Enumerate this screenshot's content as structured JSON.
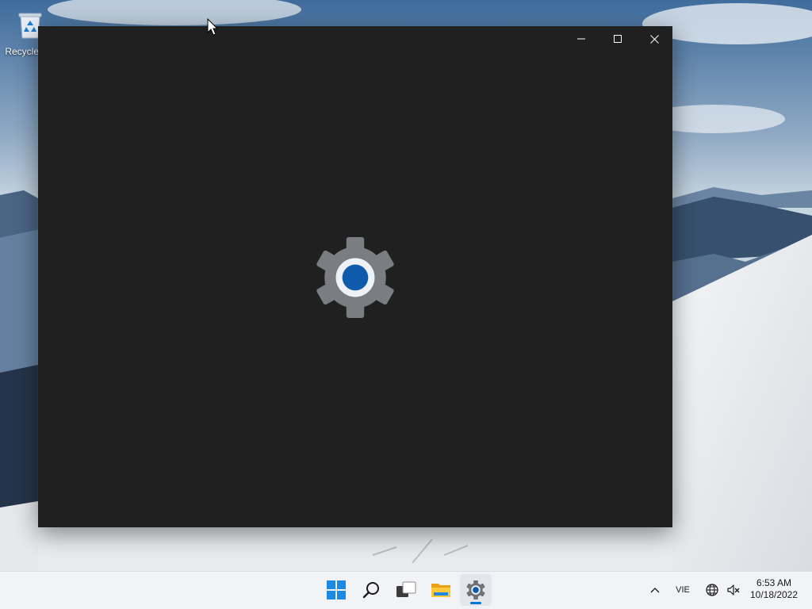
{
  "desktop": {
    "icons": [
      {
        "label": "Recycle Bin",
        "icon": "recycle-bin-icon"
      }
    ]
  },
  "window": {
    "app_icon": "settings-gear-icon",
    "caption_buttons": {
      "minimize": "minimize-icon",
      "maximize": "maximize-icon",
      "close": "close-icon"
    }
  },
  "taskbar": {
    "apps": [
      {
        "name": "Start",
        "icon": "windows-start-icon"
      },
      {
        "name": "Search",
        "icon": "search-icon"
      },
      {
        "name": "Task View",
        "icon": "task-view-icon"
      },
      {
        "name": "File Explorer",
        "icon": "folder-icon"
      },
      {
        "name": "Settings",
        "icon": "settings-gear-icon",
        "active": true
      }
    ],
    "tray": {
      "chevron_icon": "chevron-up-icon",
      "language": "VIE",
      "network_icon": "globe-network-icon",
      "volume_icon": "volume-muted-icon",
      "time": "6:53 AM",
      "date": "10/18/2022"
    }
  },
  "colors": {
    "window_bg": "#202020",
    "accent": "#0078d4",
    "taskbar_bg": "#f2f3f7",
    "gear_gray": "#7a7d82",
    "gear_blue": "#0f5aab"
  }
}
